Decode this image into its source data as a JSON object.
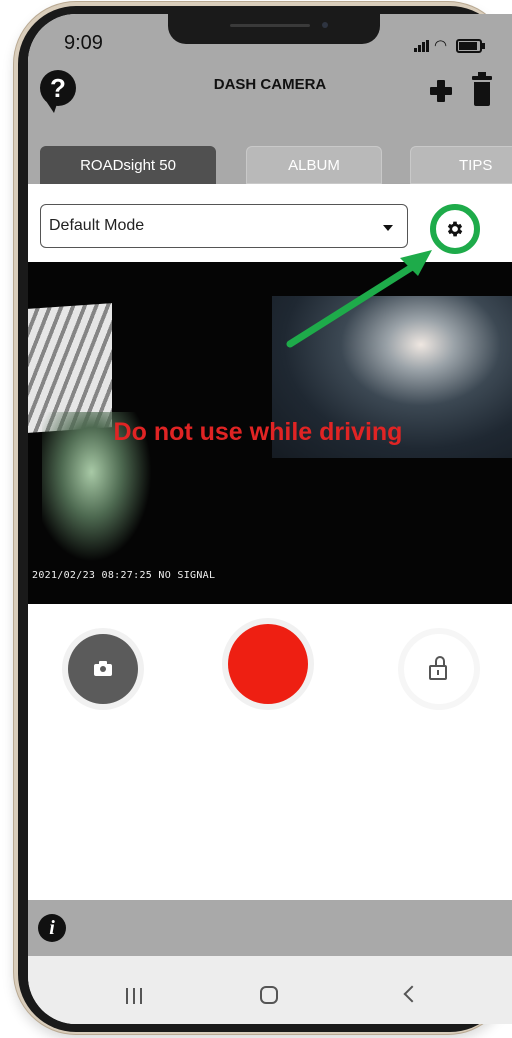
{
  "status_bar": {
    "time": "9:09"
  },
  "header": {
    "title": "DASH CAMERA"
  },
  "tabs": [
    {
      "label": "ROADsight 50",
      "active": true
    },
    {
      "label": "ALBUM",
      "active": false
    },
    {
      "label": "TIPS",
      "active": false
    }
  ],
  "mode_select": {
    "value": "Default Mode"
  },
  "preview": {
    "warning": "Do not use while driving",
    "osd_text": "2021/02/23 08:27:25 NO SIGNAL"
  },
  "icons": {
    "help": "?",
    "info": "i"
  },
  "colors": {
    "header_bg": "#a9a9a9",
    "tab_active": "#505050",
    "record": "#ee1f12",
    "highlight": "#1eab4a",
    "warning": "#e02424"
  }
}
